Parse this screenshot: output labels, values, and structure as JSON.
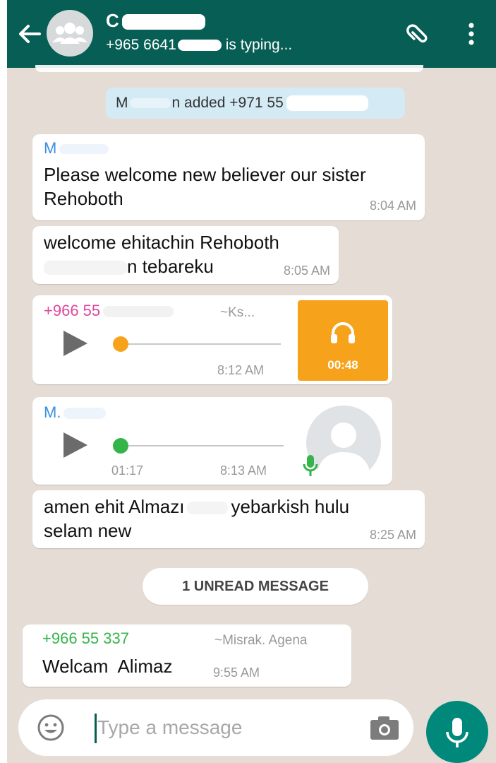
{
  "header": {
    "chat_name": "C",
    "subtitle_prefix": "+965 6641",
    "subtitle_suffix": " is typing..."
  },
  "system_message": {
    "actor": "M",
    "actor_tail": "n",
    "text": " added +971 55"
  },
  "messages": [
    {
      "sender": "M",
      "text": "Please welcome new believer our sister Rehoboth",
      "time": "8:04 AM"
    },
    {
      "line1": "welcome ehitachin Rehoboth",
      "line2": "n tebareku",
      "time": "8:05 AM"
    },
    {
      "sender": "+966 55",
      "display_name": "~Ks...",
      "time": "8:12 AM",
      "duration": "00:48"
    },
    {
      "sender": "M.",
      "elapsed": "01:17",
      "time": "8:13 AM"
    },
    {
      "part1": "amen ehit Almazı",
      "part2": "yebarkish hulu",
      "line2": "selam new",
      "time": "8:25 AM"
    },
    {
      "sender": "+966 55 337",
      "display_name": "~Misrak. Agena",
      "text": "Welcam  Alimaz",
      "time": "9:55 AM"
    }
  ],
  "unread_label": "1 UNREAD MESSAGE",
  "input": {
    "placeholder": "Type a message"
  },
  "colors": {
    "header": "#075e54",
    "chat_bg": "#e5ddd5",
    "system_pill": "#d4eaf4",
    "sender_blue": "#3b8fe0",
    "sender_pink": "#e0479e",
    "sender_green": "#35b44a",
    "audio_orange": "#f7a21b",
    "mic_button": "#00897b"
  },
  "icons": [
    "back-arrow-icon",
    "group-avatar-icon",
    "paperclip-icon",
    "more-vert-icon",
    "play-icon",
    "headphones-icon",
    "contact-avatar-icon",
    "mic-small-icon",
    "emoji-icon",
    "camera-icon",
    "mic-icon"
  ]
}
